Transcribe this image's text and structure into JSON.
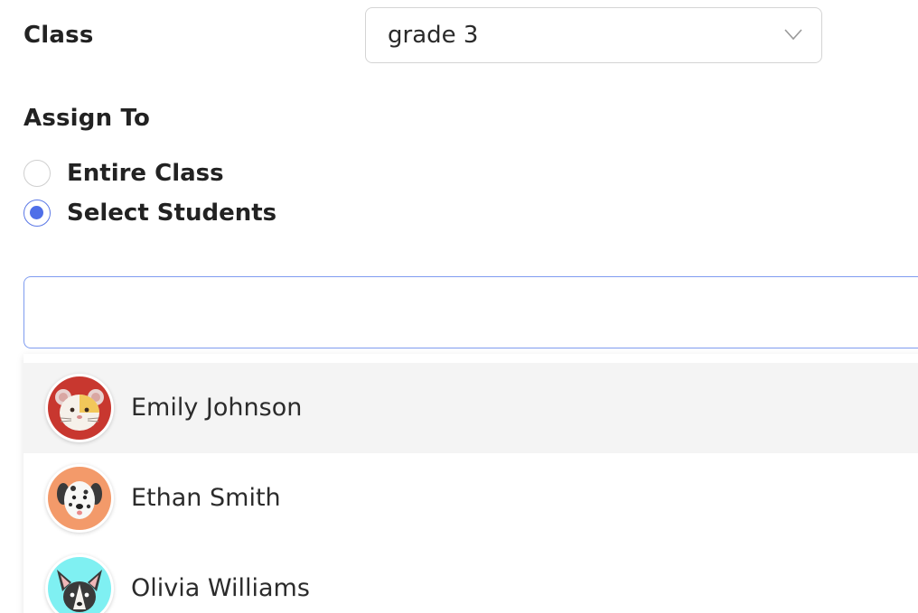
{
  "form": {
    "class_label": "Class",
    "class_select": {
      "value": "grade 3",
      "icon": "chevron-down-icon"
    },
    "assign_label": "Assign To",
    "assign_options": [
      {
        "label": "Entire Class",
        "selected": false
      },
      {
        "label": "Select Students",
        "selected": true
      }
    ],
    "search": {
      "value": "",
      "placeholder": ""
    }
  },
  "students": [
    {
      "name": "Emily Johnson",
      "avatar": "hamster-avatar",
      "avatar_bg": "#c8372f",
      "highlighted": true
    },
    {
      "name": "Ethan Smith",
      "avatar": "dalmatian-avatar",
      "avatar_bg": "#f39a6a",
      "highlighted": false
    },
    {
      "name": "Olivia Williams",
      "avatar": "chihuahua-avatar",
      "avatar_bg": "#7ff0f2",
      "highlighted": false
    }
  ],
  "colors": {
    "accent": "#4f6fe8",
    "focus_border": "#7f9cf0",
    "highlight_row": "#f4f4f4"
  }
}
